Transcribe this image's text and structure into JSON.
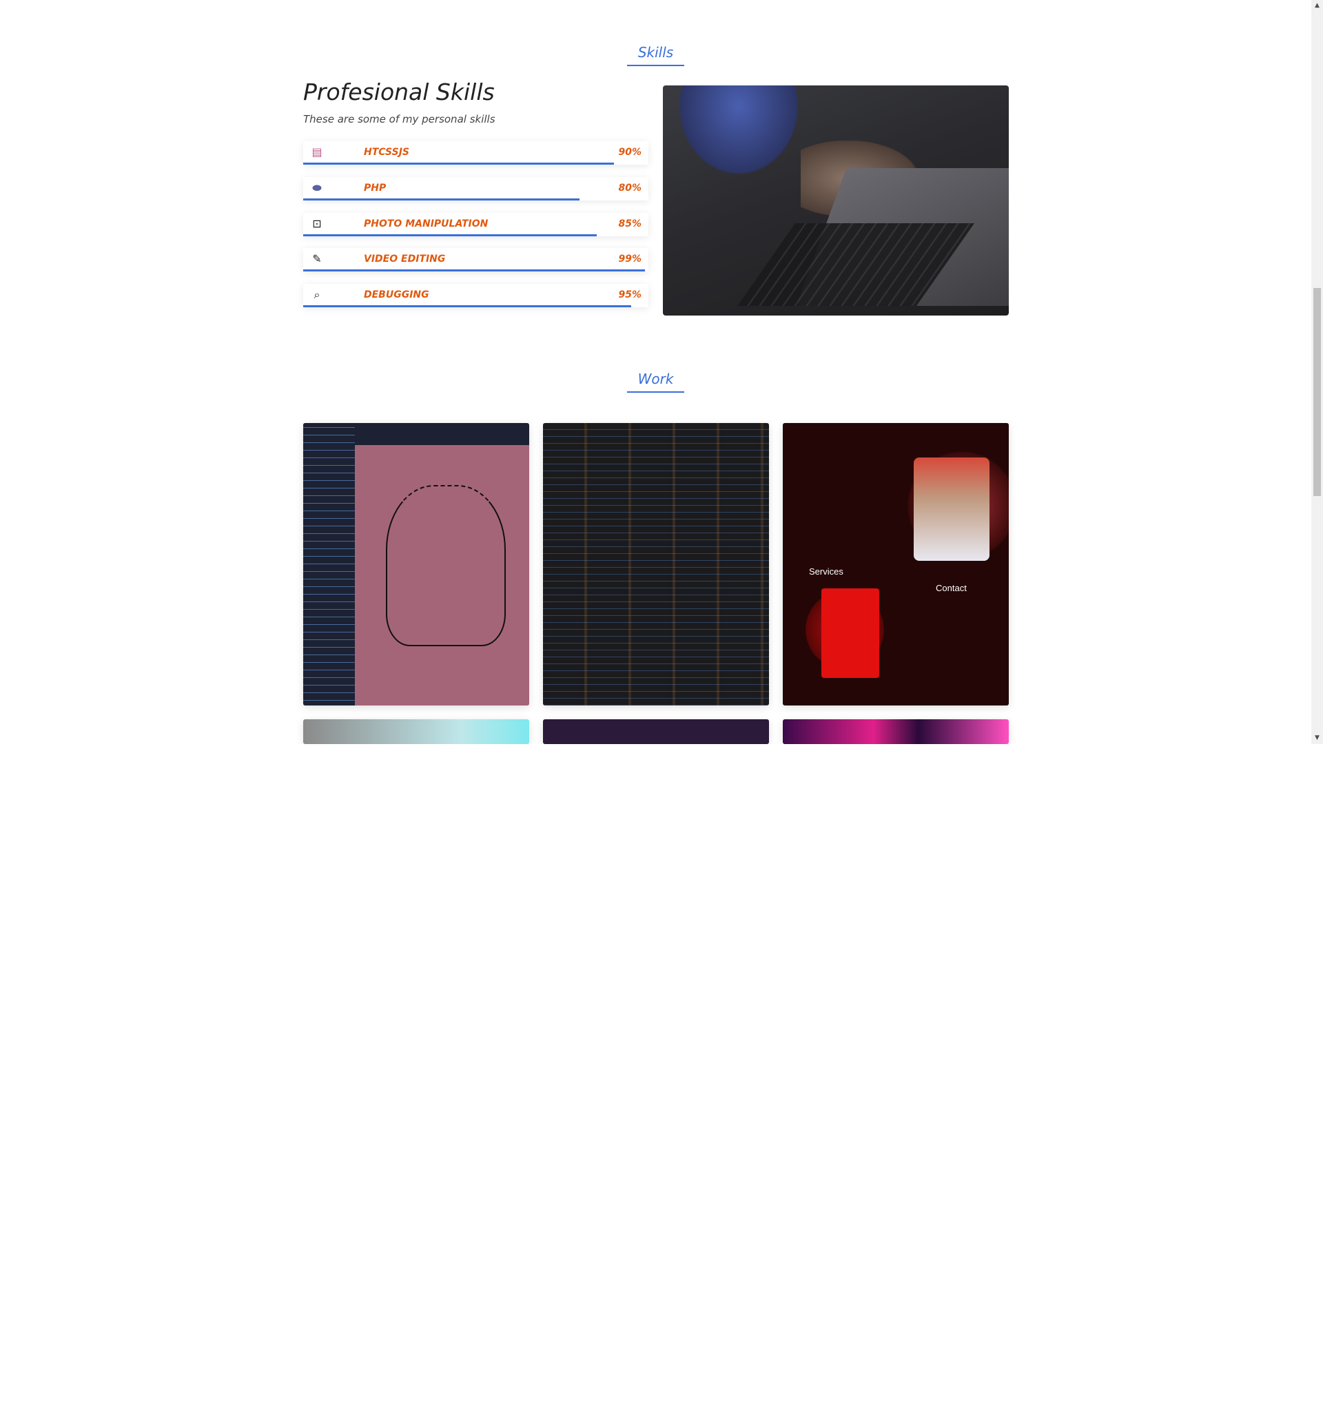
{
  "sections": {
    "skills": "Skills",
    "work": "Work"
  },
  "skills": {
    "heading": "Profesional Skills",
    "subtitle": "These are some of my personal skills",
    "items": [
      {
        "name": "HTCSSJS",
        "percent_label": "90%",
        "level": 0.9,
        "icon": "html-css-js-icon"
      },
      {
        "name": "PHP",
        "percent_label": "80%",
        "level": 0.8,
        "icon": "php-icon"
      },
      {
        "name": "PHOTO MANIPULATION",
        "percent_label": "85%",
        "level": 0.85,
        "icon": "photo-icon"
      },
      {
        "name": "VIDEO EDITING",
        "percent_label": "99%",
        "level": 0.99,
        "icon": "edit-icon"
      },
      {
        "name": "DEBUGGING",
        "percent_label": "95%",
        "level": 0.95,
        "icon": "debug-search-icon"
      }
    ]
  },
  "work": {
    "thumb3_labels": {
      "services": "Services",
      "contact": "Contact"
    }
  },
  "colors": {
    "accent": "#3a6fd8",
    "skill_text": "#e05a0f"
  }
}
